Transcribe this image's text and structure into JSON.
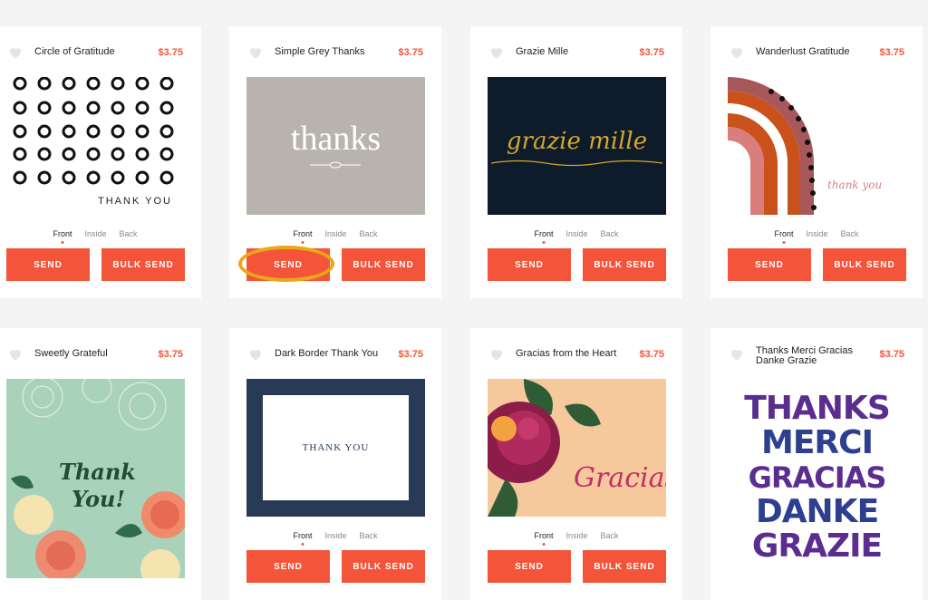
{
  "cards": [
    {
      "title": "Circle of Gratitude",
      "price": "$3.75",
      "art_text": "THANK YOU"
    },
    {
      "title": "Simple Grey Thanks",
      "price": "$3.75",
      "art_text": "thanks"
    },
    {
      "title": "Grazie Mille",
      "price": "$3.75",
      "art_text": "grazie mille"
    },
    {
      "title": "Wanderlust Gratitude",
      "price": "$3.75",
      "art_text": "thank you"
    },
    {
      "title": "Sweetly Grateful",
      "price": "$3.75",
      "art_text_1": "Thank",
      "art_text_2": "You!"
    },
    {
      "title": "Dark Border Thank You",
      "price": "$3.75",
      "art_text": "THANK YOU"
    },
    {
      "title": "Gracias from the Heart",
      "price": "$3.75",
      "art_text": "Gracias"
    },
    {
      "title": "Thanks Merci Gracias Danke Grazie",
      "price": "$3.75",
      "words": [
        "THANKS",
        "MERCI",
        "GRACIAS",
        "DANKE",
        "GRAZIE"
      ]
    }
  ],
  "tabs": {
    "front": "Front",
    "inside": "Inside",
    "back": "Back"
  },
  "buttons": {
    "send": "SEND",
    "bulk_send": "BULK SEND"
  },
  "colors": {
    "accent": "#f4553a",
    "highlight": "#e8a817"
  }
}
